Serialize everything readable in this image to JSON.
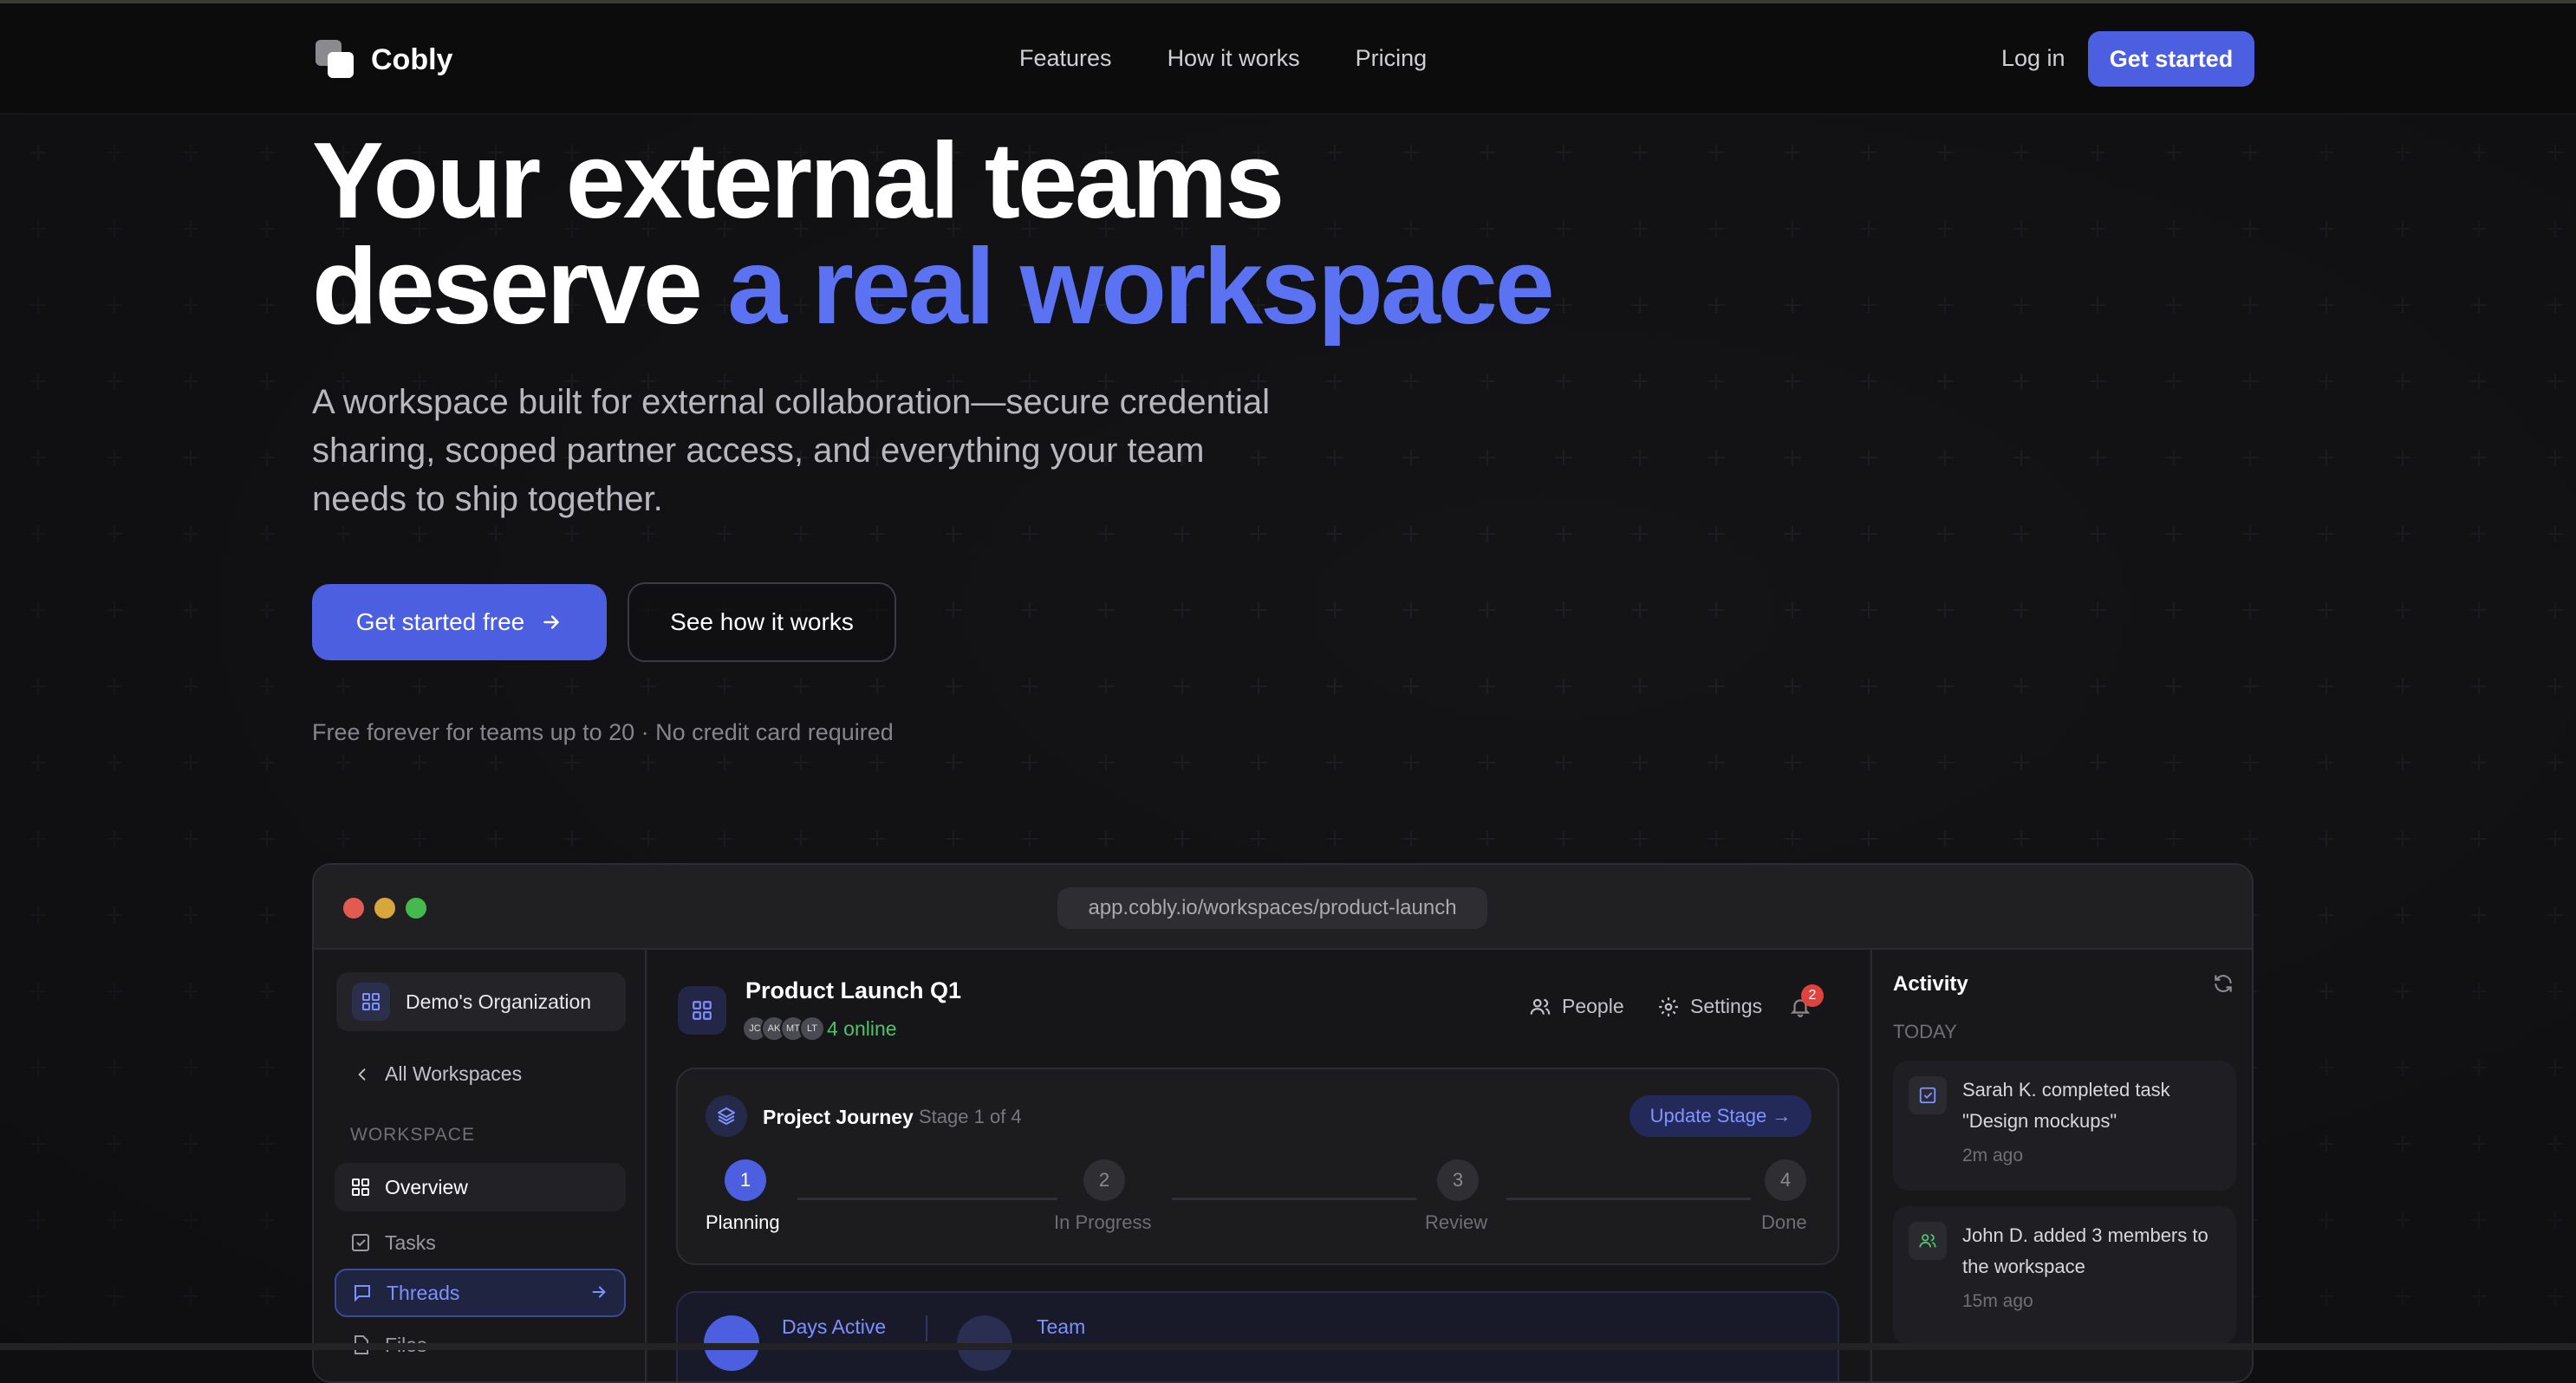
{
  "brand": {
    "name": "Cobly"
  },
  "nav": {
    "links": [
      "Features",
      "How it works",
      "Pricing"
    ],
    "login": "Log in",
    "cta": "Get started"
  },
  "hero": {
    "title_line1": "Your external teams",
    "title_line2_plain": "deserve ",
    "title_line2_accent": "a real workspace",
    "subtitle": "A workspace built for external collaboration—secure credential sharing, scoped partner access, and everything your team needs to ship together.",
    "primary_button": "Get started free",
    "secondary_button": "See how it works",
    "note": "Free forever for teams up to 20 · No credit card required"
  },
  "colors": {
    "accent": "#4c5fe0",
    "accent_text": "#5b72f2",
    "online": "#4fc26b",
    "badge": "#e0433e"
  },
  "app": {
    "url": "app.cobly.io/workspaces/product-launch",
    "sidebar": {
      "org_name": "Demo's Organization",
      "back_link": "All Workspaces",
      "section_label": "WORKSPACE",
      "items": [
        {
          "label": "Overview",
          "icon": "grid-icon"
        },
        {
          "label": "Tasks",
          "icon": "checkbox-icon"
        },
        {
          "label": "Threads",
          "icon": "chat-icon"
        },
        {
          "label": "Files",
          "icon": "file-icon"
        }
      ]
    },
    "workspace": {
      "title": "Product Launch Q1",
      "avatars": [
        "JC",
        "AK",
        "MT",
        "LT"
      ],
      "online": "4 online",
      "people_label": "People",
      "settings_label": "Settings",
      "notifications": "2"
    },
    "journey": {
      "title": "Project Journey",
      "stage": "Stage 1 of 4",
      "update_button": "Update Stage →",
      "steps": [
        {
          "num": "1",
          "label": "Planning"
        },
        {
          "num": "2",
          "label": "In Progress"
        },
        {
          "num": "3",
          "label": "Review"
        },
        {
          "num": "4",
          "label": "Done"
        }
      ]
    },
    "stats": {
      "days_active": "Days Active",
      "team": "Team"
    },
    "activity": {
      "title": "Activity",
      "today": "TODAY",
      "items": [
        {
          "text": "Sarah K. completed task \"Design mockups\"",
          "time": "2m ago"
        },
        {
          "text": "John D. added 3 members to the workspace",
          "time": "15m ago"
        }
      ]
    }
  }
}
